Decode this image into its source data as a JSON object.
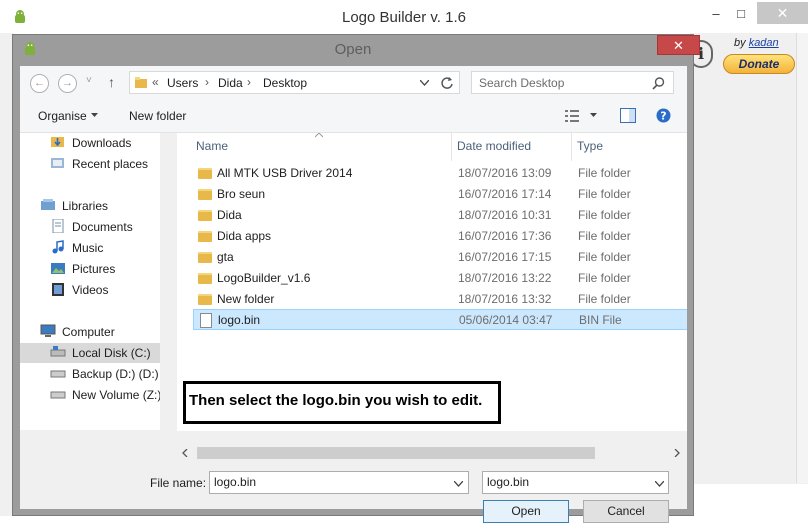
{
  "main_window": {
    "title": "Logo Builder v. 1.6",
    "minimize": "–",
    "maximize": "□",
    "close": "✕",
    "by_label": "by",
    "author_link": "kadan",
    "donate_label": "Donate",
    "info_label": "i"
  },
  "dialog": {
    "title": "Open",
    "close": "✕",
    "nav": {
      "back": "←",
      "forward": "→",
      "up": "↑",
      "recent": "˅"
    },
    "address": {
      "prefix": "«",
      "crumbs": [
        "Users",
        "Dida",
        "Desktop"
      ],
      "separator": "›"
    },
    "search": {
      "placeholder": "Search Desktop"
    },
    "toolbar": {
      "organise": "Organise",
      "new_folder": "New folder"
    },
    "sidebar": {
      "items": [
        {
          "label": "Downloads",
          "icon": "downloads-icon"
        },
        {
          "label": "Recent places",
          "icon": "recent-places-icon"
        },
        {
          "label": "Libraries",
          "icon": "libraries-icon"
        },
        {
          "label": "Documents",
          "icon": "documents-icon"
        },
        {
          "label": "Music",
          "icon": "music-icon"
        },
        {
          "label": "Pictures",
          "icon": "pictures-icon"
        },
        {
          "label": "Videos",
          "icon": "videos-icon"
        },
        {
          "label": "Computer",
          "icon": "computer-icon"
        },
        {
          "label": "Local Disk (C:)",
          "icon": "drive-icon"
        },
        {
          "label": "Backup (D:) (D:)",
          "icon": "drive-icon"
        },
        {
          "label": "New Volume (Z:)",
          "icon": "drive-icon"
        }
      ]
    },
    "columns": {
      "name": "Name",
      "date": "Date modified",
      "type": "Type"
    },
    "files": [
      {
        "name": "All MTK USB Driver 2014",
        "date": "18/07/2016 13:09",
        "type": "File folder"
      },
      {
        "name": "Bro seun",
        "date": "16/07/2016 17:14",
        "type": "File folder"
      },
      {
        "name": "Dida",
        "date": "18/07/2016 10:31",
        "type": "File folder"
      },
      {
        "name": "Dida apps",
        "date": "16/07/2016 17:36",
        "type": "File folder"
      },
      {
        "name": "gta",
        "date": "16/07/2016 17:15",
        "type": "File folder"
      },
      {
        "name": "LogoBuilder_v1.6",
        "date": "18/07/2016 13:22",
        "type": "File folder"
      },
      {
        "name": "New folder",
        "date": "18/07/2016 13:32",
        "type": "File folder"
      },
      {
        "name": "logo.bin",
        "date": "05/06/2014 03:47",
        "type": "BIN File"
      }
    ],
    "annotation": "Then select the logo.bin you wish to edit.",
    "filename_label": "File name:",
    "filename_value": "logo.bin",
    "filter_value": "logo.bin",
    "open_button": "Open",
    "cancel_button": "Cancel",
    "colors": {
      "selection": "#cce8ff",
      "folder": "#e8b94a",
      "close_red": "#c74848"
    }
  }
}
